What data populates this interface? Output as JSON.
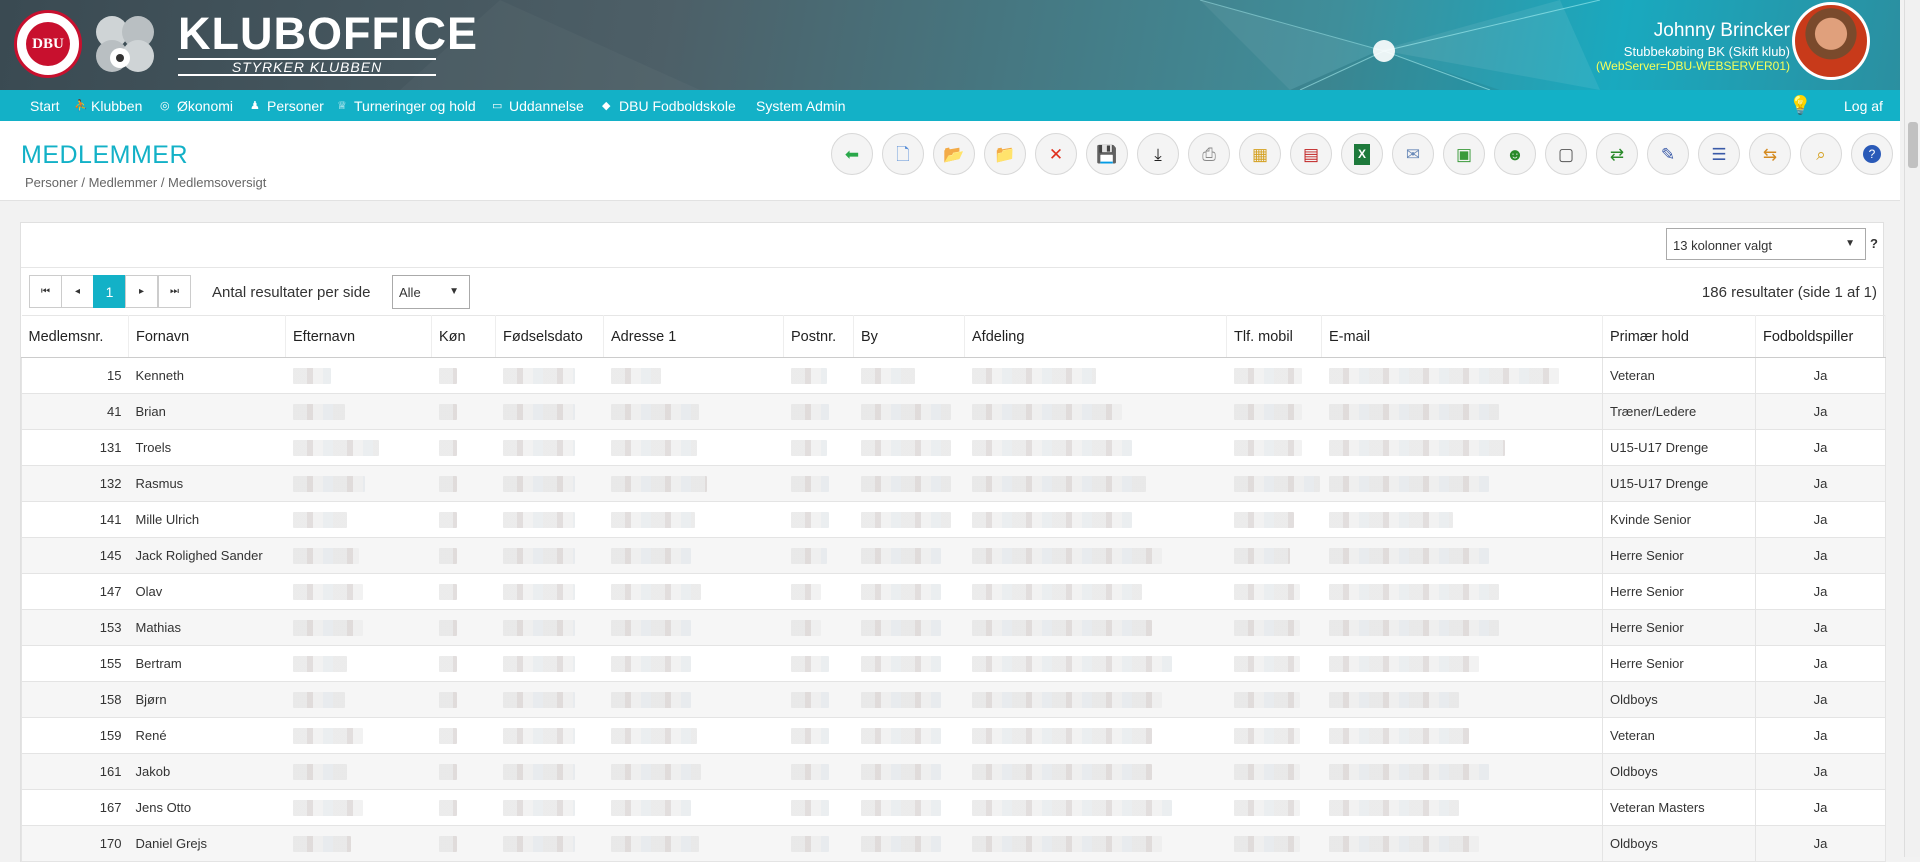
{
  "header": {
    "brand_title": "KLUBOFFICE",
    "brand_subtitle": "STYRKER KLUBBEN",
    "dbu_logo": "DBU",
    "user_name": "Johnny Brincker",
    "club": "Stubbekøbing BK (Skift klub)",
    "webserver": "(WebServer=DBU-WEBSERVER01)"
  },
  "nav": {
    "items": [
      {
        "label": "Start",
        "icon": "none"
      },
      {
        "label": "Klubben",
        "icon": "group-icon"
      },
      {
        "label": "Økonomi",
        "icon": "coin-icon"
      },
      {
        "label": "Personer",
        "icon": "person-icon"
      },
      {
        "label": "Turneringer og hold",
        "icon": "trophy-icon"
      },
      {
        "label": "Uddannelse",
        "icon": "board-icon"
      },
      {
        "label": "DBU Fodboldskole",
        "icon": "graduation-cap-icon"
      },
      {
        "label": "System Admin",
        "icon": "none"
      }
    ],
    "logout": "Log af"
  },
  "page": {
    "title": "MEDLEMMER",
    "breadcrumb": "Personer / Medlemmer / Medlemsoversigt"
  },
  "toolbar": [
    {
      "name": "back",
      "icon": "back-arrow-icon",
      "color": "#2aa84a"
    },
    {
      "name": "new",
      "icon": "new-document-icon",
      "color": "#5a8fd8"
    },
    {
      "name": "open",
      "icon": "open-folder-icon",
      "color": "#d4a020"
    },
    {
      "name": "edit",
      "icon": "edit-folder-icon",
      "color": "#d4a020"
    },
    {
      "name": "delete",
      "icon": "delete-x-icon",
      "color": "#e0301e"
    },
    {
      "name": "save",
      "icon": "save-disk-icon",
      "color": "#3a4aa8"
    },
    {
      "name": "download",
      "icon": "download-icon",
      "color": "#222222"
    },
    {
      "name": "print",
      "icon": "printer-icon",
      "color": "#888888"
    },
    {
      "name": "grid",
      "icon": "grid-icon",
      "color": "#d4a020"
    },
    {
      "name": "diff",
      "icon": "dif-file-icon",
      "color": "#c02020"
    },
    {
      "name": "excel",
      "icon": "excel-icon",
      "color": "#1e7a3c"
    },
    {
      "name": "mail",
      "icon": "envelope-icon",
      "color": "#6a8ab8"
    },
    {
      "name": "sheet",
      "icon": "green-sheet-icon",
      "color": "#3a9a3a"
    },
    {
      "name": "group",
      "icon": "people-group-icon",
      "color": "#2a8a2a"
    },
    {
      "name": "idcard",
      "icon": "id-card-icon",
      "color": "#555555"
    },
    {
      "name": "transfer",
      "icon": "people-transfer-icon",
      "color": "#2a8a2a"
    },
    {
      "name": "person-edit",
      "icon": "person-edit-icon",
      "color": "#3a5aa8"
    },
    {
      "name": "person-list",
      "icon": "person-list-icon",
      "color": "#3a5aa8"
    },
    {
      "name": "person-move",
      "icon": "person-move-icon",
      "color": "#d48a20"
    },
    {
      "name": "search",
      "icon": "magnifier-icon",
      "color": "#d4a020"
    },
    {
      "name": "help",
      "icon": "help-icon",
      "color": "#2a5ab8"
    }
  ],
  "panel": {
    "column_select": "13 kolonner valgt",
    "help_mark": "?",
    "pagination": {
      "first": "⏮",
      "prev": "◂",
      "current": "1",
      "next": "▸",
      "last": "⏭"
    },
    "per_page_label": "Antal resultater per side",
    "per_page_value": "Alle",
    "result_count": "186 resultater (side 1 af 1)"
  },
  "table": {
    "columns": [
      "Medlemsnr.",
      "Fornavn",
      "Efternavn",
      "Køn",
      "Fødselsdato",
      "Adresse 1",
      "Postnr.",
      "By",
      "Afdeling",
      "Tlf. mobil",
      "E-mail",
      "Primær hold",
      "Fodboldspiller"
    ],
    "rows": [
      {
        "nr": "15",
        "fornavn": "Kenneth",
        "hold": "Veteran",
        "spiller": "Ja"
      },
      {
        "nr": "41",
        "fornavn": "Brian",
        "hold": "Træner/Ledere",
        "spiller": "Ja"
      },
      {
        "nr": "131",
        "fornavn": "Troels",
        "hold": "U15-U17 Drenge",
        "spiller": "Ja"
      },
      {
        "nr": "132",
        "fornavn": "Rasmus",
        "hold": "U15-U17 Drenge",
        "spiller": "Ja"
      },
      {
        "nr": "141",
        "fornavn": "Mille Ulrich",
        "hold": "Kvinde Senior",
        "spiller": "Ja"
      },
      {
        "nr": "145",
        "fornavn": "Jack Rolighed Sander",
        "hold": "Herre Senior",
        "spiller": "Ja"
      },
      {
        "nr": "147",
        "fornavn": "Olav",
        "hold": "Herre Senior",
        "spiller": "Ja"
      },
      {
        "nr": "153",
        "fornavn": "Mathias",
        "hold": "Herre Senior",
        "spiller": "Ja"
      },
      {
        "nr": "155",
        "fornavn": "Bertram",
        "hold": "Herre Senior",
        "spiller": "Ja"
      },
      {
        "nr": "158",
        "fornavn": "Bjørn",
        "hold": "Oldboys",
        "spiller": "Ja"
      },
      {
        "nr": "159",
        "fornavn": "René",
        "hold": "Veteran",
        "spiller": "Ja"
      },
      {
        "nr": "161",
        "fornavn": "Jakob",
        "hold": "Oldboys",
        "spiller": "Ja"
      },
      {
        "nr": "167",
        "fornavn": "Jens Otto",
        "hold": "Veteran Masters",
        "spiller": "Ja"
      },
      {
        "nr": "170",
        "fornavn": "Daniel Grejs",
        "hold": "Oldboys",
        "spiller": "Ja"
      }
    ]
  },
  "colors": {
    "accent": "#13b1c7",
    "header_dark": "#3a4a52",
    "webserver_text": "#f5ff5a"
  }
}
